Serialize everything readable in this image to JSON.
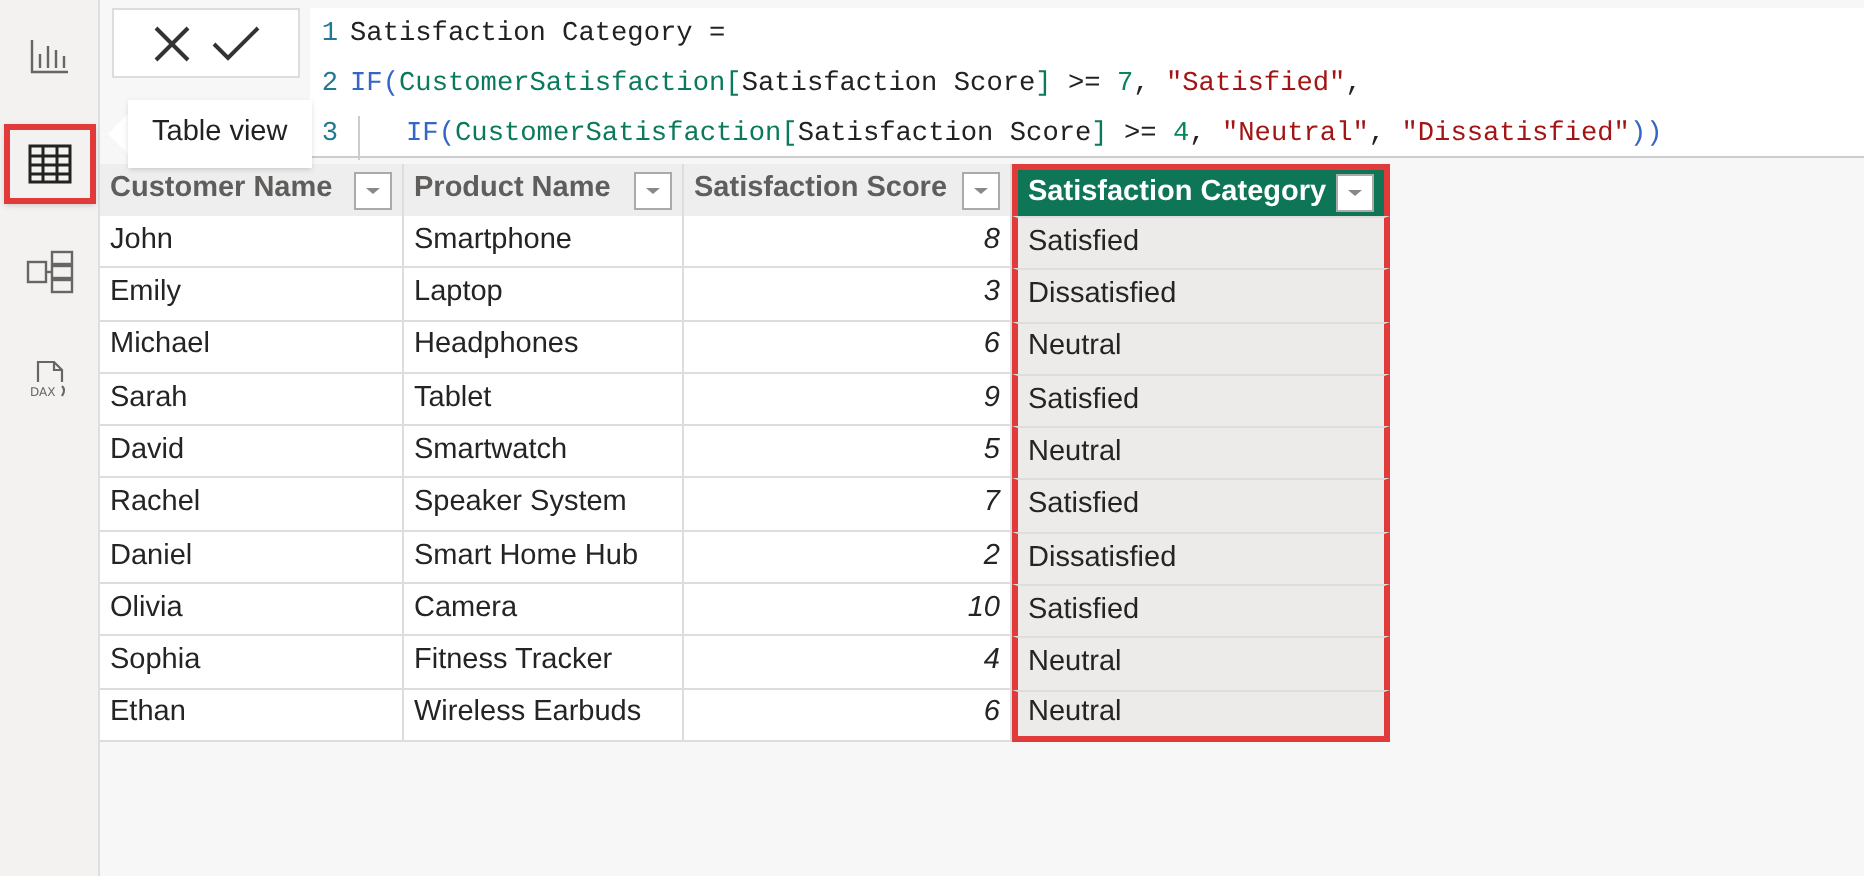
{
  "sidebar": {
    "items": [
      {
        "kind": "report",
        "selected": false
      },
      {
        "kind": "table",
        "selected": true
      },
      {
        "kind": "model",
        "selected": false
      },
      {
        "kind": "dax",
        "label": "DAX",
        "selected": false
      }
    ]
  },
  "tooltip": {
    "text": "Table view"
  },
  "formula": {
    "lines": [
      {
        "number": "1",
        "tokens": [
          {
            "kind": "plain",
            "text": "Satisfaction Category ="
          }
        ]
      },
      {
        "number": "2",
        "tokens": [
          {
            "kind": "keyword",
            "text": "IF"
          },
          {
            "kind": "paren",
            "text": "("
          },
          {
            "kind": "table",
            "text": "CustomerSatisfaction"
          },
          {
            "kind": "bracket",
            "text": "["
          },
          {
            "kind": "plain",
            "text": "Satisfaction Score"
          },
          {
            "kind": "bracket",
            "text": "]"
          },
          {
            "kind": "plain",
            "text": " >= "
          },
          {
            "kind": "number",
            "text": "7"
          },
          {
            "kind": "plain",
            "text": ", "
          },
          {
            "kind": "string",
            "text": "\"Satisfied\""
          },
          {
            "kind": "plain",
            "text": ","
          }
        ]
      },
      {
        "number": "3",
        "tokens": [
          {
            "kind": "keyword",
            "text": "IF"
          },
          {
            "kind": "paren",
            "text": "("
          },
          {
            "kind": "table",
            "text": "CustomerSatisfaction"
          },
          {
            "kind": "bracket",
            "text": "["
          },
          {
            "kind": "plain",
            "text": "Satisfaction Score"
          },
          {
            "kind": "bracket",
            "text": "]"
          },
          {
            "kind": "plain",
            "text": " >= "
          },
          {
            "kind": "number",
            "text": "4"
          },
          {
            "kind": "plain",
            "text": ", "
          },
          {
            "kind": "string",
            "text": "\"Neutral\""
          },
          {
            "kind": "plain",
            "text": ", "
          },
          {
            "kind": "string",
            "text": "\"Dissatisfied\""
          },
          {
            "kind": "paren",
            "text": ")"
          },
          {
            "kind": "paren",
            "text": ")"
          }
        ]
      }
    ]
  },
  "table": {
    "columns": [
      {
        "label": "Customer Name",
        "selected": false
      },
      {
        "label": "Product Name",
        "selected": false
      },
      {
        "label": "Satisfaction Score",
        "selected": false
      },
      {
        "label": "Satisfaction Category",
        "selected": true
      }
    ],
    "rows": [
      [
        "John",
        "Smartphone",
        "8",
        "Satisfied"
      ],
      [
        "Emily",
        "Laptop",
        "3",
        "Dissatisfied"
      ],
      [
        "Michael",
        "Headphones",
        "6",
        "Neutral"
      ],
      [
        "Sarah",
        "Tablet",
        "9",
        "Satisfied"
      ],
      [
        "David",
        "Smartwatch",
        "5",
        "Neutral"
      ],
      [
        "Rachel",
        "Speaker System",
        "7",
        "Satisfied"
      ],
      [
        "Daniel",
        "Smart Home Hub",
        "2",
        "Dissatisfied"
      ],
      [
        "Olivia",
        "Camera",
        "10",
        "Satisfied"
      ],
      [
        "Sophia",
        "Fitness Tracker",
        "4",
        "Neutral"
      ],
      [
        "Ethan",
        "Wireless Earbuds",
        "6",
        "Neutral"
      ]
    ]
  }
}
